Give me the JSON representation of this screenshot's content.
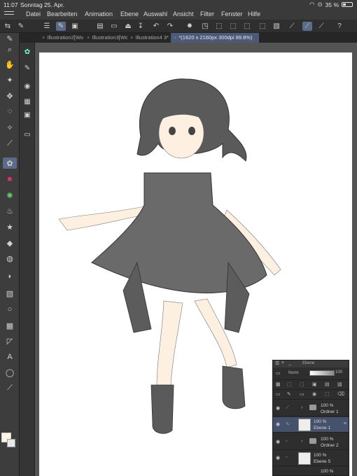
{
  "status": {
    "time": "11:07",
    "date": "Sonntag 25. Apr.",
    "battery": "35 %",
    "battery_level": 0.35
  },
  "menu": [
    "Datei",
    "Bearbeiten",
    "Animation",
    "Ebene",
    "Auswahl",
    "Ansicht",
    "Filter",
    "Fenster",
    "Hilfe"
  ],
  "tabs": [
    {
      "label": "Illustration2[Wo"
    },
    {
      "label": "Illustration3[Wo"
    },
    {
      "label": "Illustration4 3*"
    },
    {
      "label": "*(1620 x 2160px 300dpi 89.8%)"
    }
  ],
  "colors": {
    "foreground": "#fdf3e3",
    "background": "#e8e8e8",
    "accent": "#5c6b8a",
    "selected_layer": "#46526c"
  },
  "layers": {
    "title": "Ebene",
    "blend_mode": "Norm",
    "opacity_value": "100",
    "rows": [
      {
        "opacity": "100 %",
        "name": "Ordner 1",
        "type": "folder"
      },
      {
        "opacity": "100 %",
        "name": "Ebene 1",
        "type": "raster",
        "selected": true,
        "blend_short": "N:"
      },
      {
        "opacity": "100 %",
        "name": "Ordner 2",
        "type": "folder"
      },
      {
        "opacity": "100 %",
        "name": "Ebene 5",
        "type": "raster"
      },
      {
        "opacity": "100 %",
        "name": "",
        "type": "raster"
      }
    ]
  },
  "icons": {
    "sidebar": [
      "pen-icon",
      "zoom-icon",
      "hand-icon",
      "sparkle-icon",
      "move-icon",
      "lasso-icon",
      "magic-wand-icon",
      "eyedropper-icon",
      "brush-icon",
      "color-swatch-icon",
      "airbrush-icon",
      "fill-bucket-icon",
      "star-brush-icon",
      "eraser-icon",
      "blend-icon",
      "fill-icon",
      "gradient-icon",
      "shape-icon",
      "frame-icon",
      "ruler-icon",
      "text-icon",
      "balloon-icon",
      "correction-icon"
    ]
  }
}
